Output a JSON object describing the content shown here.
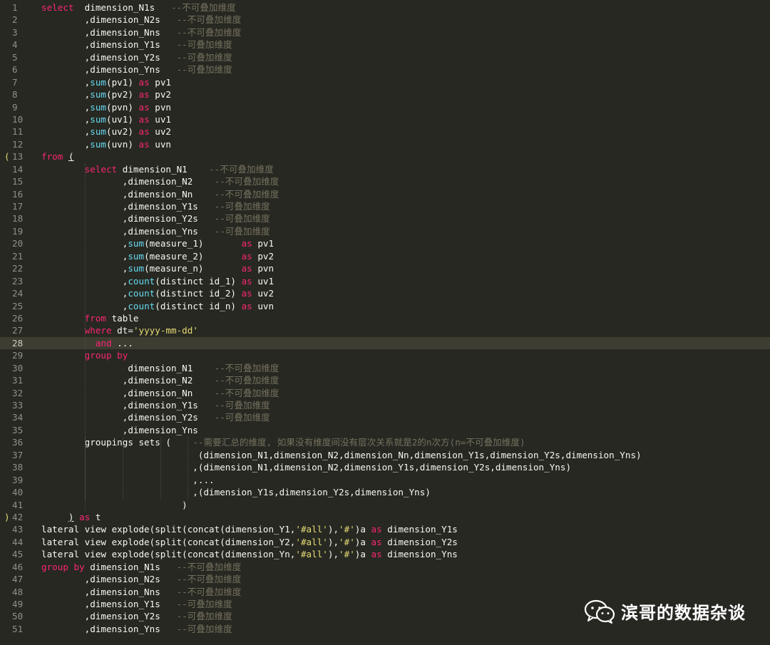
{
  "current_line": 28,
  "fold_markers": {
    "13": "(",
    "42": ")"
  },
  "colors": {
    "background": "#272822",
    "keyword": "#F92672",
    "function": "#66D9EF",
    "string": "#E6DB74",
    "comment": "#75715E",
    "text": "#F8F8F2"
  },
  "watermark": {
    "icon": "wechat-icon",
    "text": "滨哥的数据杂谈"
  },
  "lines": [
    [
      [
        "kw",
        "select"
      ],
      [
        "",
        "  dimension_N1s   "
      ],
      [
        "cm",
        "--不可叠加维度"
      ]
    ],
    [
      [
        "",
        "        ,dimension_N2s   "
      ],
      [
        "cm",
        "--不可叠加维度"
      ]
    ],
    [
      [
        "",
        "        ,dimension_Nns   "
      ],
      [
        "cm",
        "--不可叠加维度"
      ]
    ],
    [
      [
        "",
        "        ,dimension_Y1s   "
      ],
      [
        "cm",
        "--可叠加维度"
      ]
    ],
    [
      [
        "",
        "        ,dimension_Y2s   "
      ],
      [
        "cm",
        "--可叠加维度"
      ]
    ],
    [
      [
        "",
        "        ,dimension_Yns   "
      ],
      [
        "cm",
        "--可叠加维度"
      ]
    ],
    [
      [
        "",
        "        ,"
      ],
      [
        "fn",
        "sum"
      ],
      [
        "",
        "(pv1) "
      ],
      [
        "kw",
        "as"
      ],
      [
        "",
        " pv1"
      ]
    ],
    [
      [
        "",
        "        ,"
      ],
      [
        "fn",
        "sum"
      ],
      [
        "",
        "(pv2) "
      ],
      [
        "kw",
        "as"
      ],
      [
        "",
        " pv2"
      ]
    ],
    [
      [
        "",
        "        ,"
      ],
      [
        "fn",
        "sum"
      ],
      [
        "",
        "(pvn) "
      ],
      [
        "kw",
        "as"
      ],
      [
        "",
        " pvn"
      ]
    ],
    [
      [
        "",
        "        ,"
      ],
      [
        "fn",
        "sum"
      ],
      [
        "",
        "(uv1) "
      ],
      [
        "kw",
        "as"
      ],
      [
        "",
        " uv1"
      ]
    ],
    [
      [
        "",
        "        ,"
      ],
      [
        "fn",
        "sum"
      ],
      [
        "",
        "(uv2) "
      ],
      [
        "kw",
        "as"
      ],
      [
        "",
        " uv2"
      ]
    ],
    [
      [
        "",
        "        ,"
      ],
      [
        "fn",
        "sum"
      ],
      [
        "",
        "(uvn) "
      ],
      [
        "kw",
        "as"
      ],
      [
        "",
        " uvn"
      ]
    ],
    [
      [
        "kw",
        "from"
      ],
      [
        "",
        " "
      ],
      [
        "u",
        "("
      ]
    ],
    [
      [
        "",
        "        "
      ],
      [
        "kw",
        "select"
      ],
      [
        "",
        " dimension_N1    "
      ],
      [
        "cm",
        "--不可叠加维度"
      ]
    ],
    [
      [
        "",
        "               ,dimension_N2    "
      ],
      [
        "cm",
        "--不可叠加维度"
      ]
    ],
    [
      [
        "",
        "               ,dimension_Nn    "
      ],
      [
        "cm",
        "--不可叠加维度"
      ]
    ],
    [
      [
        "",
        "               ,dimension_Y1s   "
      ],
      [
        "cm",
        "--可叠加维度"
      ]
    ],
    [
      [
        "",
        "               ,dimension_Y2s   "
      ],
      [
        "cm",
        "--可叠加维度"
      ]
    ],
    [
      [
        "",
        "               ,dimension_Yns   "
      ],
      [
        "cm",
        "--可叠加维度"
      ]
    ],
    [
      [
        "",
        "               ,"
      ],
      [
        "fn",
        "sum"
      ],
      [
        "",
        "(measure_1)       "
      ],
      [
        "kw",
        "as"
      ],
      [
        "",
        " pv1"
      ]
    ],
    [
      [
        "",
        "               ,"
      ],
      [
        "fn",
        "sum"
      ],
      [
        "",
        "(measure_2)       "
      ],
      [
        "kw",
        "as"
      ],
      [
        "",
        " pv2"
      ]
    ],
    [
      [
        "",
        "               ,"
      ],
      [
        "fn",
        "sum"
      ],
      [
        "",
        "(measure_n)       "
      ],
      [
        "kw",
        "as"
      ],
      [
        "",
        " pvn"
      ]
    ],
    [
      [
        "",
        "               ,"
      ],
      [
        "fn",
        "count"
      ],
      [
        "",
        "(distinct id_1) "
      ],
      [
        "kw",
        "as"
      ],
      [
        "",
        " uv1"
      ]
    ],
    [
      [
        "",
        "               ,"
      ],
      [
        "fn",
        "count"
      ],
      [
        "",
        "(distinct id_2) "
      ],
      [
        "kw",
        "as"
      ],
      [
        "",
        " uv2"
      ]
    ],
    [
      [
        "",
        "               ,"
      ],
      [
        "fn",
        "count"
      ],
      [
        "",
        "(distinct id_n) "
      ],
      [
        "kw",
        "as"
      ],
      [
        "",
        " uvn"
      ]
    ],
    [
      [
        "",
        "        "
      ],
      [
        "kw",
        "from"
      ],
      [
        "",
        " table"
      ]
    ],
    [
      [
        "",
        "        "
      ],
      [
        "kw",
        "where"
      ],
      [
        "",
        " dt="
      ],
      [
        "str",
        "'yyyy-mm-dd'"
      ]
    ],
    [
      [
        "",
        "          "
      ],
      [
        "kw",
        "and"
      ],
      [
        "",
        " ..."
      ]
    ],
    [
      [
        "",
        "        "
      ],
      [
        "kw",
        "group by"
      ]
    ],
    [
      [
        "",
        "                dimension_N1    "
      ],
      [
        "cm",
        "--不可叠加维度"
      ]
    ],
    [
      [
        "",
        "               ,dimension_N2    "
      ],
      [
        "cm",
        "--不可叠加维度"
      ]
    ],
    [
      [
        "",
        "               ,dimension_Nn    "
      ],
      [
        "cm",
        "--不可叠加维度"
      ]
    ],
    [
      [
        "",
        "               ,dimension_Y1s   "
      ],
      [
        "cm",
        "--可叠加维度"
      ]
    ],
    [
      [
        "",
        "               ,dimension_Y2s   "
      ],
      [
        "cm",
        "--可叠加维度"
      ]
    ],
    [
      [
        "",
        "               ,dimension_Yns"
      ]
    ],
    [
      [
        "",
        "        groupings sets (    "
      ],
      [
        "cm",
        "--需要汇总的维度, 如果没有维度间没有层次关系就是2的n次方(n=不可叠加维度)"
      ]
    ],
    [
      [
        "",
        "                             (dimension_N1,dimension_N2,dimension_Nn,dimension_Y1s,dimension_Y2s,dimension_Yns)"
      ]
    ],
    [
      [
        "",
        "                            ,(dimension_N1,dimension_N2,dimension_Y1s,dimension_Y2s,dimension_Yns)"
      ]
    ],
    [
      [
        "",
        "                            ,..."
      ]
    ],
    [
      [
        "",
        "                            ,(dimension_Y1s,dimension_Y2s,dimension_Yns)"
      ]
    ],
    [
      [
        "",
        "                          )"
      ]
    ],
    [
      [
        "",
        "     "
      ],
      [
        "u",
        ")"
      ],
      [
        "",
        " "
      ],
      [
        "kw",
        "as"
      ],
      [
        "",
        " t"
      ]
    ],
    [
      [
        "",
        "lateral view explode(split(concat(dimension_Y1,"
      ],
      [
        "str",
        "'#all'"
      ],
      [
        "",
        "),"
      ],
      [
        "str",
        "'#'"
      ],
      [
        "",
        ")a "
      ],
      [
        "kw",
        "as"
      ],
      [
        "",
        " dimension_Y1s"
      ]
    ],
    [
      [
        "",
        "lateral view explode(split(concat(dimension_Y2,"
      ],
      [
        "str",
        "'#all'"
      ],
      [
        "",
        "),"
      ],
      [
        "str",
        "'#'"
      ],
      [
        "",
        ")a "
      ],
      [
        "kw",
        "as"
      ],
      [
        "",
        " dimension_Y2s"
      ]
    ],
    [
      [
        "",
        "lateral view explode(split(concat(dimension_Yn,"
      ],
      [
        "str",
        "'#all'"
      ],
      [
        "",
        "),"
      ],
      [
        "str",
        "'#'"
      ],
      [
        "",
        ")a "
      ],
      [
        "kw",
        "as"
      ],
      [
        "",
        " dimension_Yns"
      ]
    ],
    [
      [
        "kw",
        "group by"
      ],
      [
        "",
        " dimension_N1s   "
      ],
      [
        "cm",
        "--不可叠加维度"
      ]
    ],
    [
      [
        "",
        "        ,dimension_N2s   "
      ],
      [
        "cm",
        "--不可叠加维度"
      ]
    ],
    [
      [
        "",
        "        ,dimension_Nns   "
      ],
      [
        "cm",
        "--不可叠加维度"
      ]
    ],
    [
      [
        "",
        "        ,dimension_Y1s   "
      ],
      [
        "cm",
        "--可叠加维度"
      ]
    ],
    [
      [
        "",
        "        ,dimension_Y2s   "
      ],
      [
        "cm",
        "--可叠加维度"
      ]
    ],
    [
      [
        "",
        "        ,dimension_Yns   "
      ],
      [
        "cm",
        "--可叠加维度"
      ]
    ]
  ]
}
